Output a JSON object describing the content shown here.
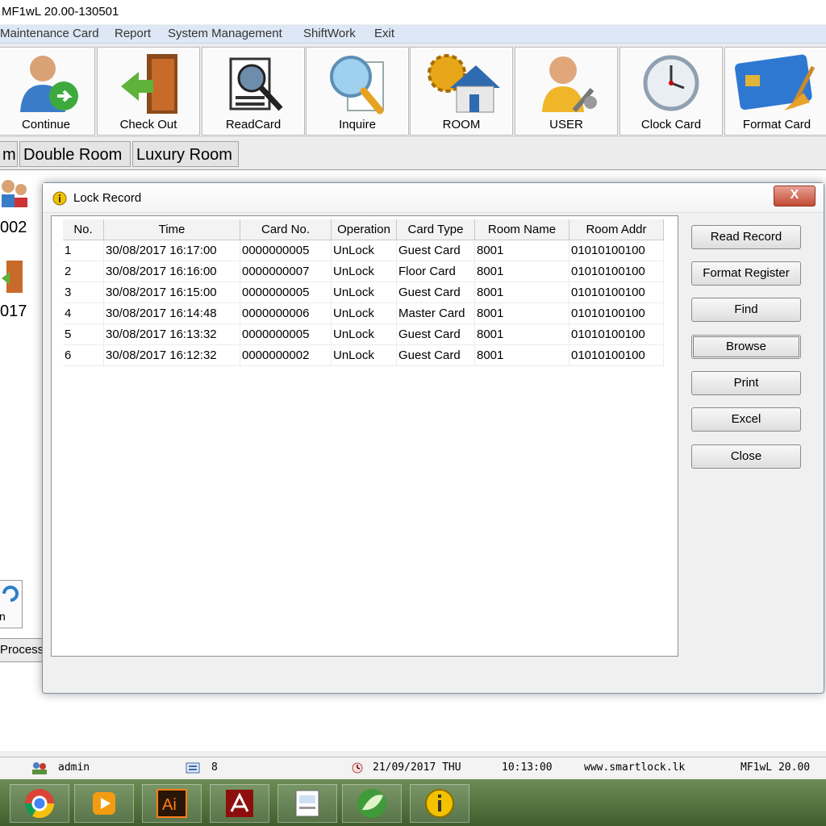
{
  "window": {
    "title": "MF1wL 20.00-130501"
  },
  "menu": [
    "Maintenance Card",
    "Report",
    "System Management",
    "ShiftWork",
    "Exit"
  ],
  "toolbar": [
    {
      "label": "Continue",
      "icon": "user-continue-icon"
    },
    {
      "label": "Check Out",
      "icon": "door-exit-icon"
    },
    {
      "label": "ReadCard",
      "icon": "card-reader-icon"
    },
    {
      "label": "Inquire",
      "icon": "magnifier-icon"
    },
    {
      "label": "ROOM",
      "icon": "house-gear-icon"
    },
    {
      "label": "USER",
      "icon": "user-wrench-icon"
    },
    {
      "label": "Clock Card",
      "icon": "clock-icon"
    },
    {
      "label": "Format Card",
      "icon": "card-broom-icon"
    }
  ],
  "room_tabs": [
    "m",
    "Double Room",
    "Luxury Room"
  ],
  "background": {
    "room_a": "002",
    "room_b": "017",
    "process": "Process",
    "btn_partial": "n"
  },
  "dialog": {
    "title": "Lock Record",
    "close": "X",
    "columns": [
      "No.",
      "Time",
      "Card No.",
      "Operation",
      "Card Type",
      "Room Name",
      "Room Addr"
    ],
    "rows": [
      [
        "1",
        "30/08/2017 16:17:00",
        "0000000005",
        "UnLock",
        "Guest Card",
        "8001",
        "01010100100"
      ],
      [
        "2",
        "30/08/2017 16:16:00",
        "0000000007",
        "UnLock",
        "Floor Card",
        "8001",
        "01010100100"
      ],
      [
        "3",
        "30/08/2017 16:15:00",
        "0000000005",
        "UnLock",
        "Guest Card",
        "8001",
        "01010100100"
      ],
      [
        "4",
        "30/08/2017 16:14:48",
        "0000000006",
        "UnLock",
        "Master Card",
        "8001",
        "01010100100"
      ],
      [
        "5",
        "30/08/2017 16:13:32",
        "0000000005",
        "UnLock",
        "Guest Card",
        "8001",
        "01010100100"
      ],
      [
        "6",
        "30/08/2017 16:12:32",
        "0000000002",
        "UnLock",
        "Guest Card",
        "8001",
        "01010100100"
      ]
    ],
    "buttons": [
      "Read Record",
      "Format Register",
      "Find",
      "Browse",
      "Print",
      "Excel",
      "Close"
    ]
  },
  "status": {
    "user": "admin",
    "count": "8",
    "date": "21/09/2017 THU",
    "time": "10:13:00",
    "site": "www.smartlock.lk",
    "version": "MF1wL 20.00"
  },
  "taskbar": [
    "chrome-icon",
    "media-player-icon",
    "illustrator-icon",
    "acrobat-icon",
    "document-icon",
    "app-leaf-icon",
    "lock-app-icon"
  ]
}
